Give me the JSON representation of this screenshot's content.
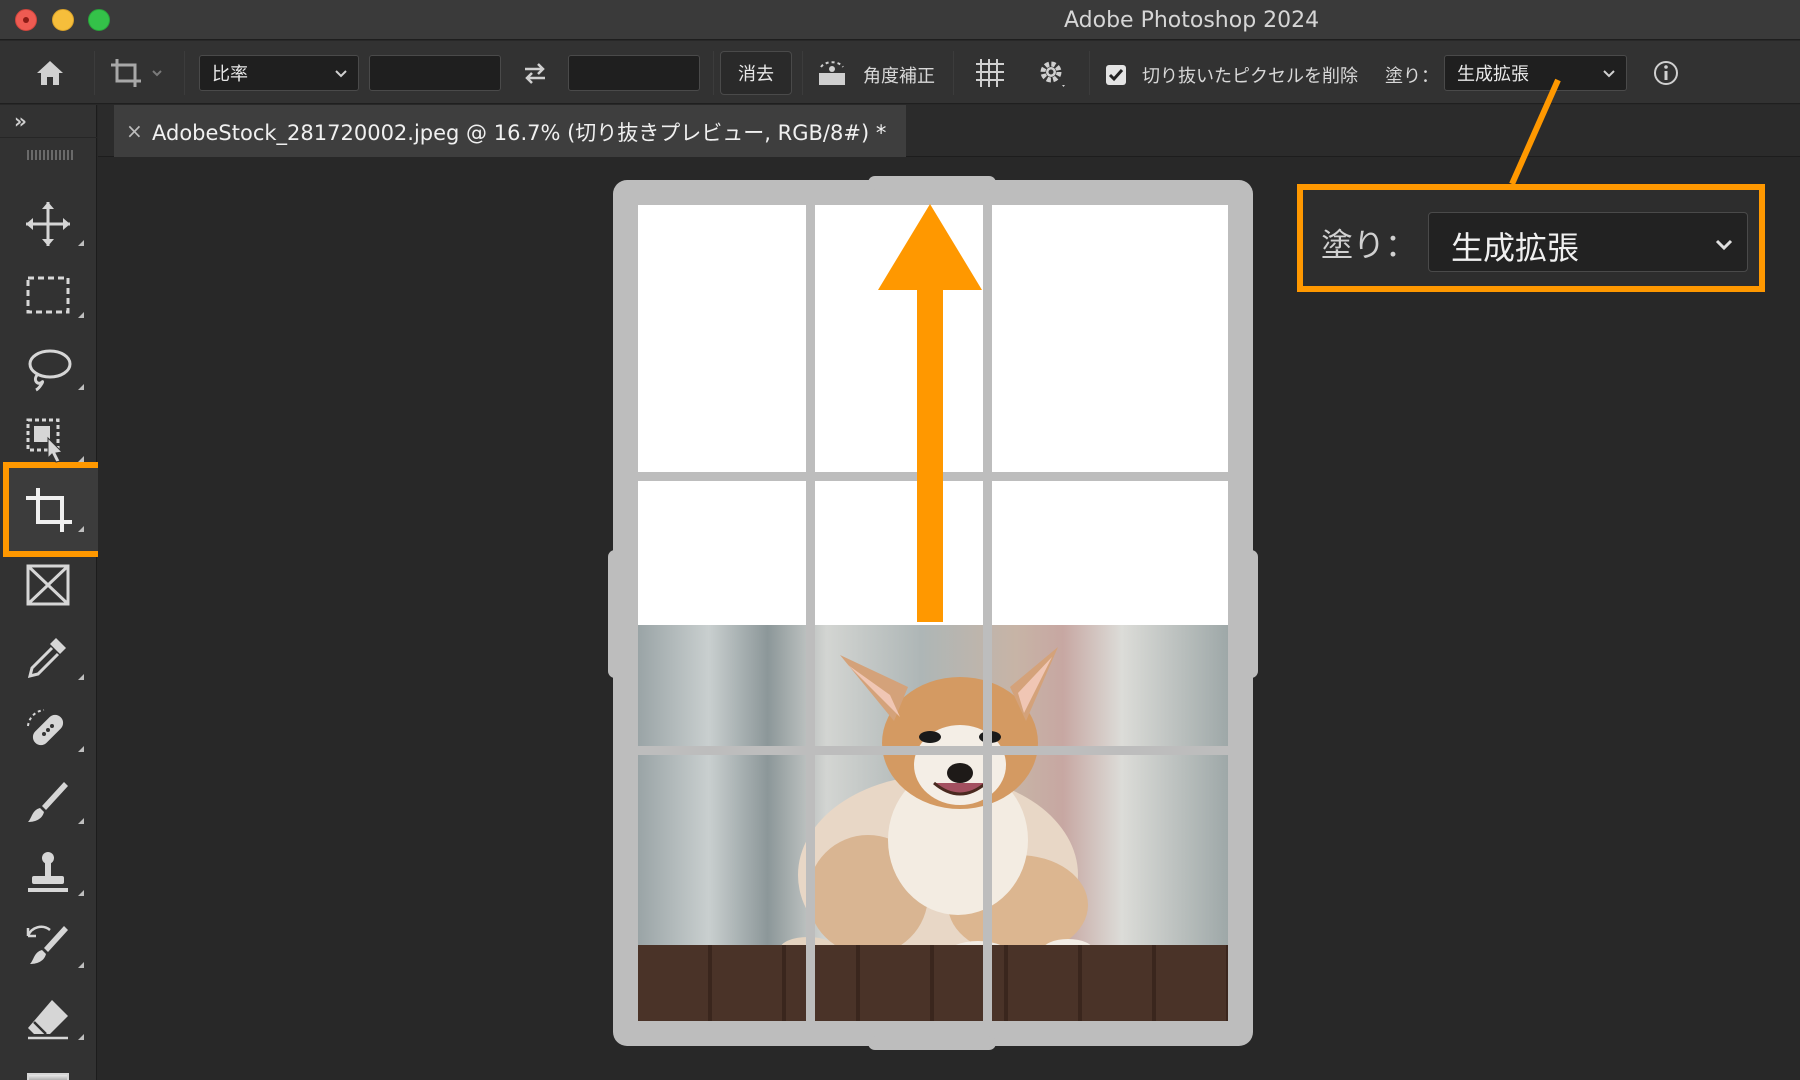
{
  "window": {
    "title": "Adobe Photoshop 2024"
  },
  "options_bar": {
    "ratio_select": "比率",
    "clear_button": "消去",
    "straighten_label": "角度補正",
    "delete_pixels_label": "切り抜いたピクセルを削除",
    "fill_label": "塗り：",
    "fill_select": "生成拡張",
    "delete_pixels_checked": true
  },
  "toolbar": {
    "collapse": "»",
    "tools": [
      "move-tool",
      "rectangular-marquee-tool",
      "lasso-tool",
      "object-selection-tool",
      "crop-tool",
      "frame-tool",
      "eyedropper-tool",
      "spot-healing-brush-tool",
      "brush-tool",
      "clone-stamp-tool",
      "history-brush-tool",
      "eraser-tool",
      "gradient-tool"
    ],
    "active_tool": "crop-tool"
  },
  "document": {
    "tab_close": "×",
    "tab_title": "AdobeStock_281720002.jpeg @ 16.7% (切り抜きプレビュー, RGB/8#) *"
  },
  "annotation": {
    "callout_label": "塗り：",
    "callout_value": "生成拡張",
    "accent_color": "#ff9800"
  }
}
